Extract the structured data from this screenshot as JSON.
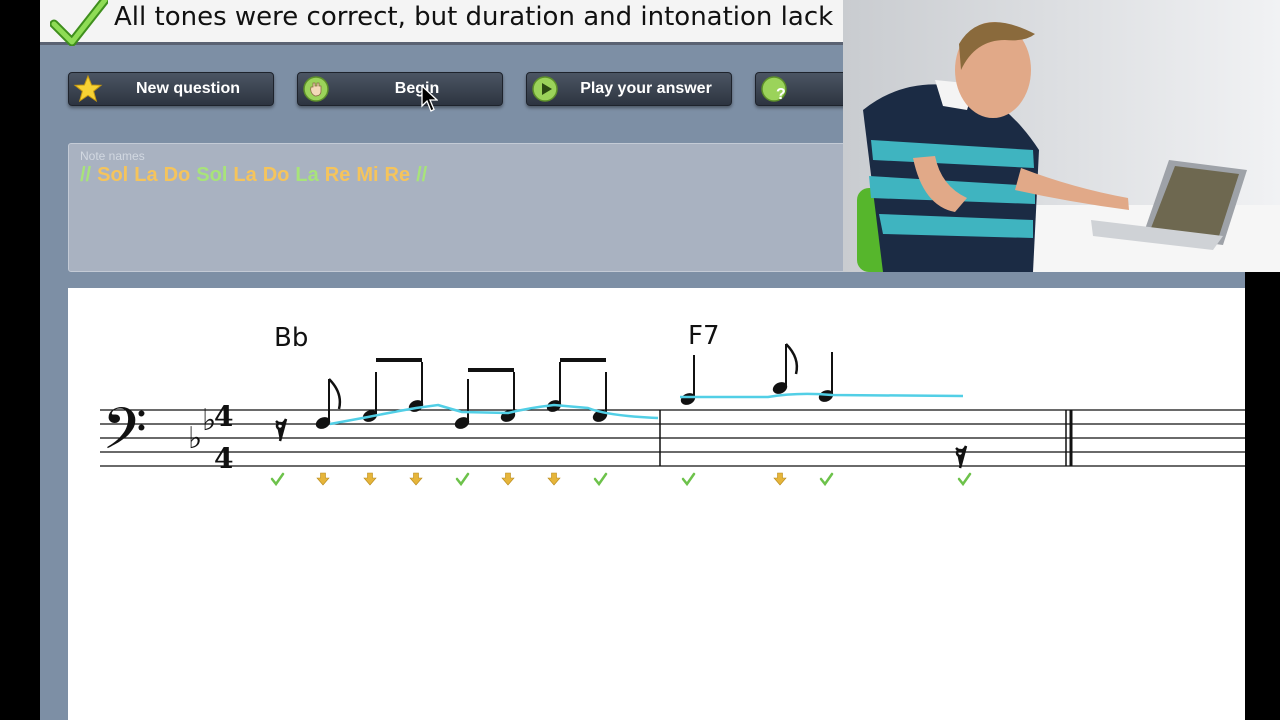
{
  "feedback": {
    "text": "All tones were correct, but duration and intonation lack"
  },
  "toolbar": [
    {
      "label": "New question",
      "icon": "star-icon"
    },
    {
      "label": "Begin",
      "icon": "hand-play-icon"
    },
    {
      "label": "Play your answer",
      "icon": "play-disc-icon"
    },
    {
      "label": "Pla",
      "icon": "play-question-icon"
    }
  ],
  "note_panel": {
    "label": "Note names",
    "notes": [
      {
        "text": "//",
        "status": "ok"
      },
      {
        "text": "Sol",
        "status": "warn"
      },
      {
        "text": "La",
        "status": "warn"
      },
      {
        "text": "Do",
        "status": "warn"
      },
      {
        "text": "Sol",
        "status": "ok"
      },
      {
        "text": "La",
        "status": "warn"
      },
      {
        "text": "Do",
        "status": "warn"
      },
      {
        "text": "La",
        "status": "ok"
      },
      {
        "text": "Re",
        "status": "warn"
      },
      {
        "text": "Mi",
        "status": "warn"
      },
      {
        "text": "Re",
        "status": "warn"
      },
      {
        "text": "//",
        "status": "ok"
      }
    ]
  },
  "score": {
    "chords": [
      "Bb",
      "F7"
    ],
    "markers": [
      "check",
      "down",
      "down",
      "down",
      "check",
      "down",
      "down",
      "check",
      "check",
      "down",
      "check",
      "check"
    ]
  },
  "colors": {
    "ok": "#a8e37a",
    "warn": "#f5c45c",
    "pitch_trace": "#52cfe6",
    "marker_ok": "#6dc24b",
    "marker_warn": "#e6b53a"
  }
}
